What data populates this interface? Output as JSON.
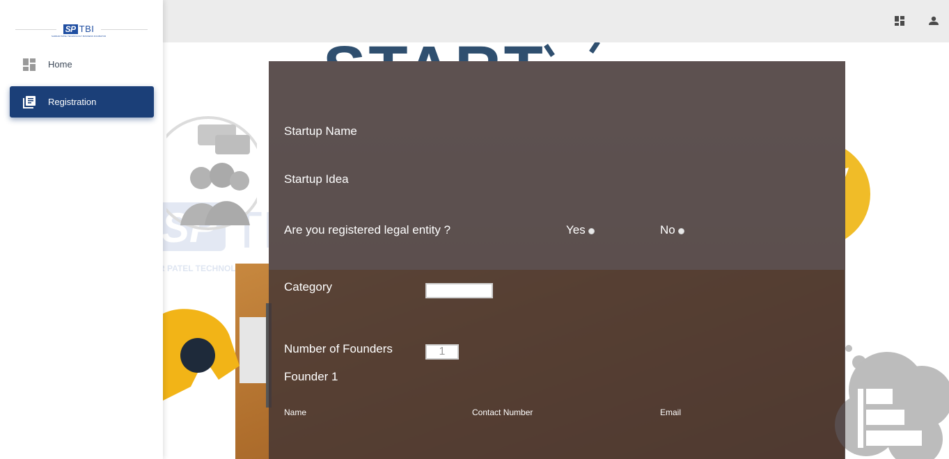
{
  "sidebar": {
    "logo": {
      "mark_left": "SP",
      "mark_right": "TBI",
      "tagline": "SARDAR PATEL TECHNOLOGY BUSINESS INCUBATOR"
    },
    "items": [
      {
        "label": "Home",
        "icon": "dashboard-icon",
        "active": false
      },
      {
        "label": "Registration",
        "icon": "library-books-icon",
        "active": true
      }
    ]
  },
  "topbar": {
    "icons": [
      "dashboard-icon",
      "person-icon"
    ]
  },
  "background": {
    "watermark_text": "R PATEL TECHNOLOGY BUSINESS INCUB"
  },
  "form": {
    "startup_name_label": "Startup Name",
    "startup_idea_label": "Startup Idea",
    "registered_label": "Are you registered legal entity ?",
    "yes_label": "Yes",
    "no_label": "No",
    "category_label": "Category",
    "category_value": "",
    "founders_label": "Number of Founders",
    "founders_value": "1",
    "founder1_label": "Founder 1",
    "col_name": "Name",
    "col_contact": "Contact Number",
    "col_email": "Email"
  },
  "colors": {
    "accent": "#1b3f78",
    "panel_overlay": "#423434",
    "topbar": "#ececec"
  }
}
